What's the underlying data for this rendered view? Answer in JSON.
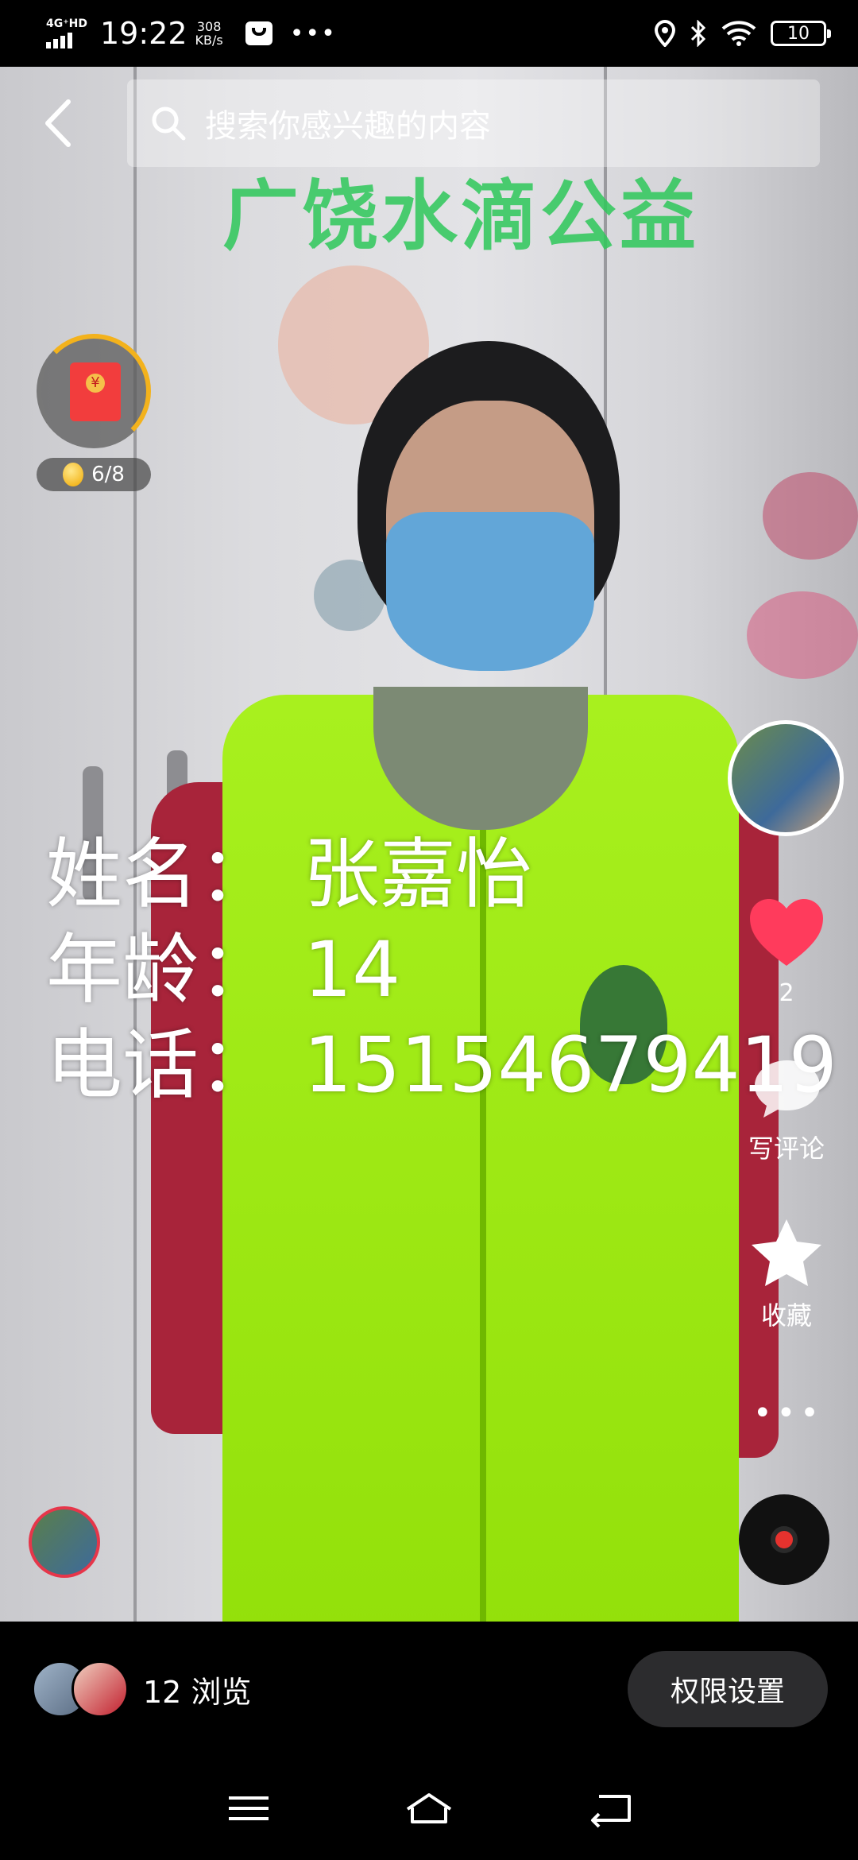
{
  "status_bar": {
    "network": "4G⁺HD",
    "time": "19:22",
    "speed_value": "308",
    "speed_unit": "KB/s",
    "more": "•••",
    "battery": "10"
  },
  "search": {
    "placeholder": "搜索你感兴趣的内容"
  },
  "video": {
    "watermark": "广饶水滴公益",
    "info": [
      {
        "label": "姓名：",
        "value": "张嘉怡"
      },
      {
        "label": "年龄：",
        "value": "14"
      },
      {
        "label": "电话：",
        "value": "15154679419"
      }
    ]
  },
  "reward": {
    "progress_text": "6/8"
  },
  "actions": {
    "like_count": "2",
    "comment_label": "写评论",
    "favorite_label": "收藏",
    "more": "•••"
  },
  "bottom": {
    "views_text": "12 浏览",
    "permission_button": "权限设置"
  },
  "colors": {
    "like": "#ff3b5c",
    "reward_ring": "#f3b21c",
    "vest": "#a8f01e"
  }
}
